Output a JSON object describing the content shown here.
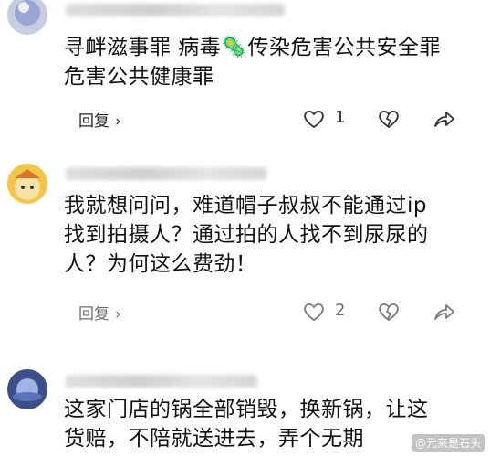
{
  "comments": [
    {
      "lines": [
        "寻衅滋事罪 病毒🦠传染危害公共安全罪",
        "危害公共健康罪"
      ],
      "reply_label": "回复",
      "chevron": "›",
      "like_count": "1"
    },
    {
      "lines": [
        "我就想问问，难道帽子叔叔不能通过ip",
        "找到拍摄人？通过拍的人找不到尿尿的",
        "人？为何这么费劲！"
      ],
      "reply_label": "回复",
      "chevron": "›",
      "like_count": "2"
    },
    {
      "lines": [
        "这家门店的锅全部销毁，换新锅，让这",
        "货赔，不陪就送进去，弄个无期"
      ]
    }
  ],
  "watermark": "@元来是石头",
  "colors": {
    "text": "#111111",
    "icon": "#333333",
    "blur_meta": "#cccccc"
  }
}
